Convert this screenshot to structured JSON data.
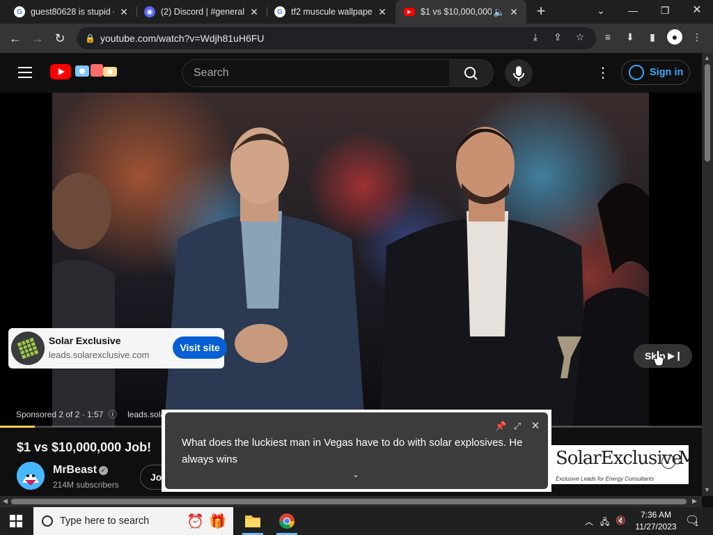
{
  "browser": {
    "tabs": [
      {
        "title": "guest80628 is stupid -",
        "favicon": "google-icon"
      },
      {
        "title": "(2) Discord | #general",
        "favicon": "discord-icon"
      },
      {
        "title": "tf2 muscule wallpaper",
        "favicon": "google-icon"
      },
      {
        "title": "$1 vs $10,000,000",
        "favicon": "youtube-icon",
        "active": true
      }
    ],
    "new_tab_label": "+",
    "url": "youtube.com/watch?v=Wdjh81uH6FU"
  },
  "youtube": {
    "search_placeholder": "Search",
    "sign_in_label": "Sign in",
    "accent_color": "#3ea6ff",
    "brand_color": "#ff0000"
  },
  "ad": {
    "advertiser": "Solar Exclusive",
    "domain": "leads.solarexclusive.com",
    "visit_label": "Visit site",
    "skip_label": "Skip",
    "sponsored_text": "Sponsored 2 of 2 · 1:57",
    "sponsored_link": "leads.solar",
    "progress_fraction": 0.05
  },
  "video": {
    "title": "$1 vs $10,000,000 Job!",
    "channel": "MrBeast",
    "subscribers": "214M subscribers",
    "join_label": "Jo"
  },
  "banner": {
    "brand": "SolarExclusive",
    "brand_tail": "M",
    "tagline": "Exclusive Leads for Energy Consultants"
  },
  "caption": {
    "text": "What does the luckiest man in Vegas have to do with solar explosives. He always wins"
  },
  "taskbar": {
    "search_placeholder": "Type here to search",
    "time": "7:36 AM",
    "date": "11/27/2023",
    "notification_count": "1"
  }
}
